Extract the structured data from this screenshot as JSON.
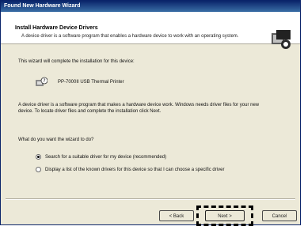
{
  "window": {
    "title": "Found New Hardware Wizard"
  },
  "header": {
    "title": "Install Hardware Device Drivers",
    "subtitle": "A device driver is a software program that enables a hardware device to work with an operating system."
  },
  "body": {
    "intro": "This wizard will complete the installation for this device:",
    "device_name": "PP-7000II USB Thermal Printer",
    "description": "A device driver is a software program that makes a hardware device work. Windows needs driver files for your new device. To locate driver files and complete the installation click Next.",
    "question": "What do you want the wizard to do?",
    "options": [
      {
        "label": "Search for a suitable driver for my device (recommended)",
        "selected": true
      },
      {
        "label": "Display a list of the known drivers for this device so that I can choose a specific driver",
        "selected": false
      }
    ]
  },
  "buttons": {
    "back": "< Back",
    "next": "Next >",
    "cancel": "Cancel"
  },
  "icons": {
    "wizard": "hardware-wizard-icon",
    "device": "device-question-icon"
  },
  "colors": {
    "title_bar": "#0a246a",
    "dialog_bg": "#ece9d8",
    "header_bg": "#ffffff"
  }
}
